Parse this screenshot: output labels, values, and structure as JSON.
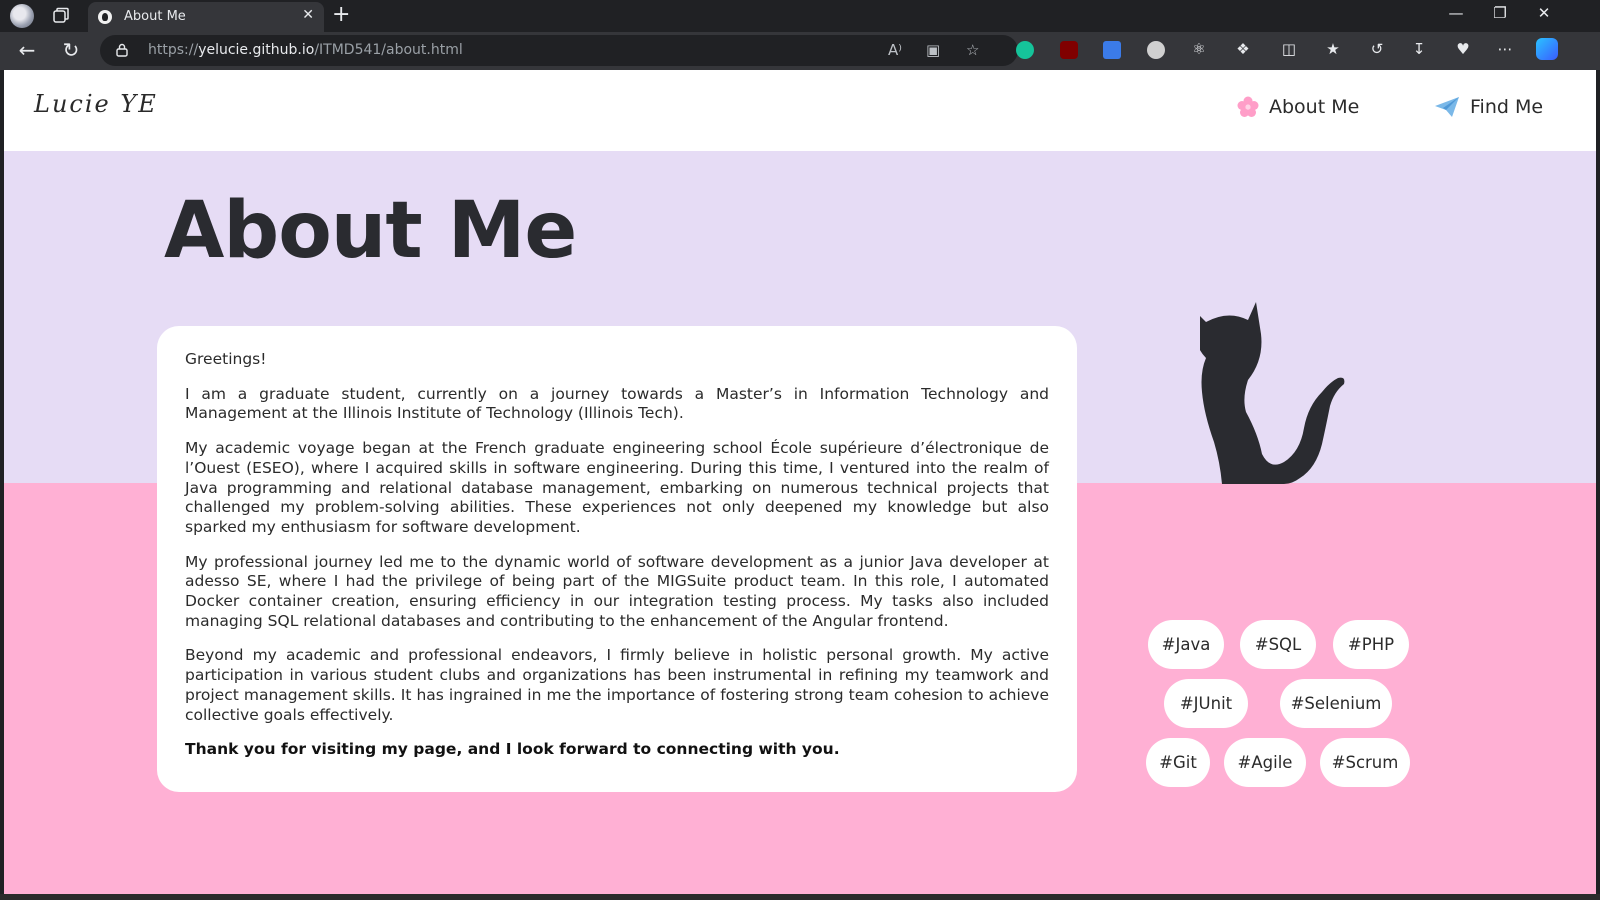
{
  "browser": {
    "tab_title": "About Me",
    "url_prefix": "https://",
    "url_host": "yelucie.github.io",
    "url_path": "/ITMD541/about.html",
    "new_tab_label": "+",
    "close_tab_label": "✕",
    "reader_label": "A⁾"
  },
  "site": {
    "logo": "Lucie YE",
    "nav": [
      {
        "label": "About Me",
        "icon": "flower-icon"
      },
      {
        "label": "Find Me",
        "icon": "paper-plane-icon"
      }
    ],
    "page_title": "About Me"
  },
  "about": {
    "greeting": "Greetings!",
    "p1": "I am a graduate student, currently on a journey towards a Master’s in Information Technology and Management at the Illinois Institute of Technology (Illinois Tech).",
    "p2": "My academic voyage began at the French graduate engineering school École supérieure d’électronique de l’Ouest (ESEO), where I acquired skills in software engineering. During this time, I ventured into the realm of Java programming and relational database management, embarking on numerous technical projects that challenged my problem-solving abilities. These experiences not only deepened my knowledge but also sparked my enthusiasm for software development.",
    "p3": "My professional journey led me to the dynamic world of software development as a junior Java developer at adesso SE, where I had the privilege of being part of the MIGSuite product team. In this role, I automated Docker container creation, ensuring efficiency in our integration testing process. My tasks also included managing SQL relational databases and contributing to the enhancement of the Angular frontend.",
    "p4": "Beyond my academic and professional endeavors, I firmly believe in holistic personal growth. My active participation in various student clubs and organizations has been instrumental in refining my teamwork and project management skills. It has ingrained in me the importance of fostering strong team cohesion to achieve collective goals effectively.",
    "closing": "Thank you for visiting my page, and I look forward to connecting with you."
  },
  "tags": [
    "#Java",
    "#SQL",
    "#PHP",
    "#JUnit",
    "#Selenium",
    "#Git",
    "#Agile",
    "#Scrum"
  ],
  "colors": {
    "lavender": "#e6dcf5",
    "pink": "#ffb0d4",
    "text": "#2b2b2b",
    "nav_flower": "#ff9ec8",
    "nav_plane": "#7ab8e8"
  }
}
